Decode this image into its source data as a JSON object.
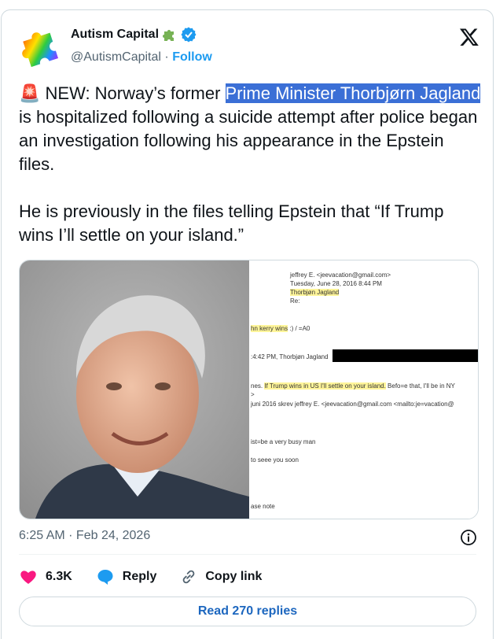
{
  "account": {
    "display_name": "Autism Capital",
    "handle": "@AutismCapital",
    "separator": "·",
    "follow_label": "Follow",
    "badge_icons": [
      "puzzle-piece-icon",
      "verified-badge-icon"
    ]
  },
  "post": {
    "emoji": "🚨",
    "lead": " NEW: Norway’s former ",
    "highlighted": "Prime Minister Thorbjørn Jagland",
    "rest": " is hospitalized following a suicide attempt after police began an investigation following his appearance in the Epstein files.",
    "paragraph2": "He is previously in the files telling Epstein that “If Trump wins I’ll settle on your island.”"
  },
  "document": {
    "from": "jeffrey E. <jeevacation@gmail.com>",
    "date": "Tuesday, June 28, 2016 8:44 PM",
    "to": "Thorbjøn Jagland",
    "re": "Re:",
    "line1_hl": "hn kerry wins",
    "line1_rest": " :) / =A0",
    "line2": ":4:42 PM, Thorbjøn Jagland",
    "line3_pre": "nes. ",
    "line3_hl": "If Trump wins in US I'll settle on your island.",
    "line3_post": " Befo=e that, I'll be in NY",
    "line3b": ">",
    "line4": "juni 2016 skrev jeffrey E. <jeevacation@gmail.com <mailto:je=vacation@",
    "line5": "ist=be a very busy man",
    "line6": "to seeе you soon",
    "line7": "ase note"
  },
  "meta": {
    "timestamp": "6:25 AM · Feb 24, 2026"
  },
  "actions": {
    "likes": "6.3K",
    "reply_label": "Reply",
    "copy_link_label": "Copy link"
  },
  "footer": {
    "read_replies_label": "Read 270 replies"
  },
  "colors": {
    "follow": "#1d9bf0",
    "highlight": "#3b6fd6",
    "like": "#f91880",
    "reply": "#1d9bf0",
    "replies_button_text": "#1d67bf"
  }
}
